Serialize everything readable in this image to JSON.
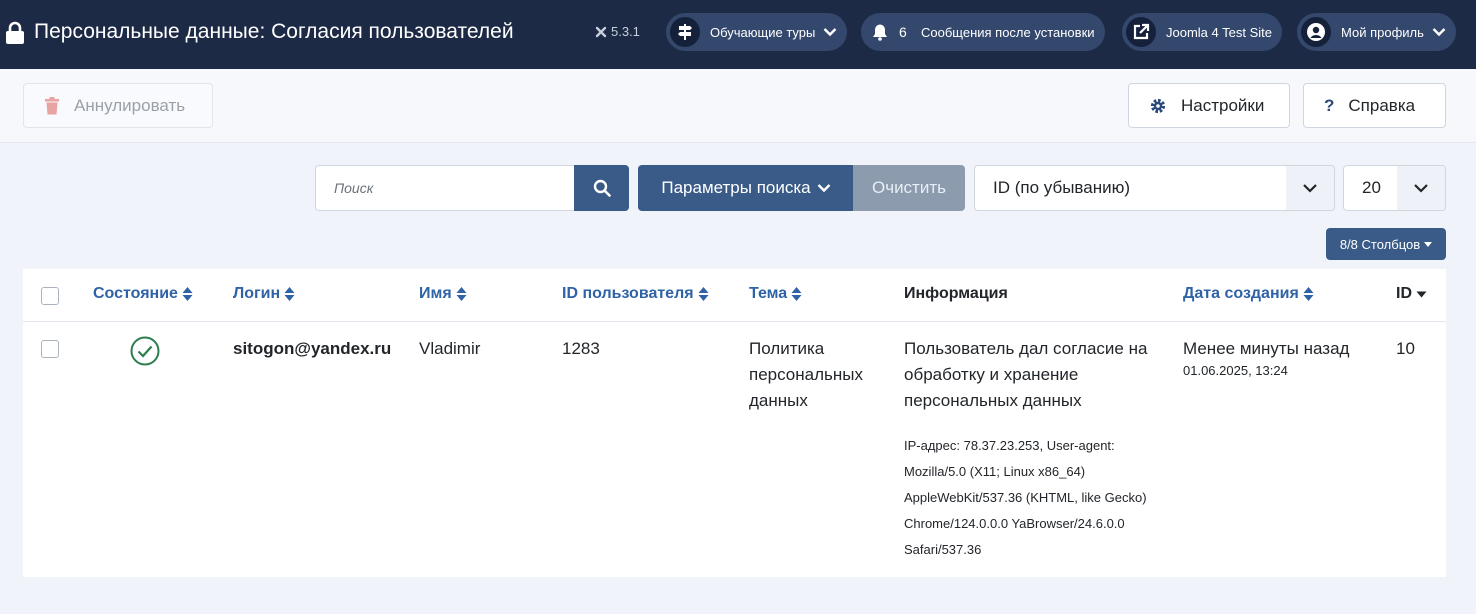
{
  "header": {
    "title": "Персональные данные: Согласия пользователей",
    "version": "5.3.1",
    "guided_tours": "Обучающие туры",
    "notifications_count": "6",
    "post_install": "Сообщения после установки",
    "site": "Joomla 4 Test Site",
    "profile": "Мой профиль"
  },
  "toolbar": {
    "revoke": "Аннулировать",
    "options": "Настройки",
    "help": "Справка"
  },
  "filters": {
    "search_placeholder": "Поиск",
    "search_options": "Параметры поиска",
    "clear": "Очистить",
    "ordering": "ID (по убыванию)",
    "limit": "20",
    "columns": "8/8 Столбцов"
  },
  "table": {
    "headers": {
      "state": "Состояние",
      "login": "Логин",
      "name": "Имя",
      "user_id": "ID пользователя",
      "subject": "Тема",
      "info": "Информация",
      "created": "Дата создания",
      "id": "ID"
    },
    "rows": [
      {
        "login": "sitogon@yandex.ru",
        "name": "Vladimir",
        "user_id": "1283",
        "subject": "Политика персональных данных",
        "info": "Пользователь дал согласие на обработку и хранение персональных данных",
        "info_details": "IP-адрес: 78.37.23.253, User-agent: Mozilla/5.0 (X11; Linux x86_64) AppleWebKit/537.36 (KHTML, like Gecko) Chrome/124.0.0.0 YaBrowser/24.6.0.0 Safari/537.36",
        "created_relative": "Менее минуты назад",
        "created_date": "01.06.2025, 13:24",
        "id": "10"
      }
    ]
  },
  "colors": {
    "header_bg": "#1c2a45",
    "accent": "#3a5a87",
    "link": "#2f63a6",
    "success": "#2e7d4f"
  }
}
